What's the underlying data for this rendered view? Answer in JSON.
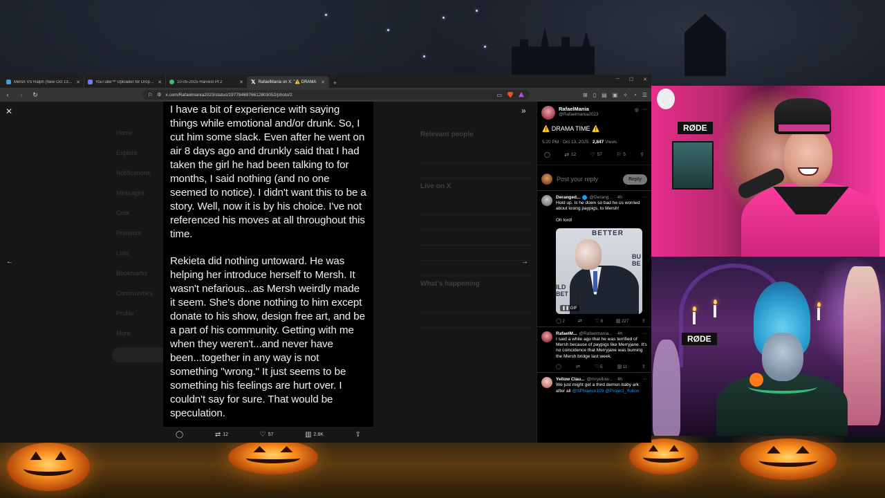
{
  "browser": {
    "tabs": [
      {
        "label": "Mersh VS Ralph (New Oct 13th) - Gi",
        "color": "#3aa0e0",
        "active": false
      },
      {
        "label": "YouTube™ Uploader for Dropbox, D",
        "color": "#6a7cff",
        "active": false
      },
      {
        "label": "10-05-2025 Harvest Pt 2",
        "color": "#3cc06a",
        "active": false
      },
      {
        "label": "RafaelMania on X: \"⚠️ DRAMA",
        "color": "#e7e9ea",
        "active": true
      }
    ],
    "new_tab": "+",
    "url": "x.com/Rafaelmania2023/status/1977846976612803052/photo/2"
  },
  "photo": {
    "paragraphs": [
      "I have a bit of experience with saying things while emotional and/or drunk. So, I cut him some slack. Even after he went on air 8 days ago and drunkly said that I had taken the girl he had been talking to for months, I said nothing (and no one seemed to notice). I didn't want this to be a story. Well, now it is by his choice. I've not referenced his moves at all throughout this time.",
      "Rekieta did nothing untoward. He was helping her introduce herself to Mersh. It wasn't nefarious...as Mersh weirdly made it seem. She's done nothing to him except donate to his show, design free art, and be a part of his community. Getting with me when they weren't...and never have been...together in any way is not something \"wrong.\" It just seems to be something his feelings are hurt over. I couldn't say for sure. That would be speculation."
    ],
    "actions": {
      "reposts": "12",
      "likes": "57",
      "views": "2.8K"
    }
  },
  "background_page": {
    "nav": [
      "Home",
      "Explore",
      "Notifications",
      "Messages",
      "Grok",
      "Premium",
      "Lists",
      "Bookmarks",
      "Communities",
      "Profile",
      "More"
    ],
    "sidebar_heading_1": "Relevant people",
    "sidebar_heading_2": "Live on X",
    "sidebar_heading_3": "What's happening"
  },
  "panel": {
    "author": {
      "name": "RafaelMania",
      "handle": "@Rafaelmania2023"
    },
    "text": "⚠️ DRAMA TIME ⚠️",
    "meta": {
      "time": "5:20 PM · Oct 13, 2025 · ",
      "views": "2,847",
      "views_label": " Views"
    },
    "counts": {
      "reposts": "12",
      "likes": "57",
      "bookmarks": "5"
    },
    "reply_placeholder": "Post your reply",
    "reply_button": "Reply",
    "replies": [
      {
        "name": "Deranged...",
        "handle": "@Derang...",
        "time": "· 4h",
        "verified": true,
        "text": "Hold up. Is he down so bad he us worried about losing paypigs, to Mersh!\n\nOh lord!",
        "media": {
          "better": "BETTER",
          "bu": "BU\nBE",
          "ild": "ILD\nBET",
          "gif": "GIF"
        },
        "counts": {
          "replies": "2",
          "reposts": "",
          "likes": "8",
          "views": "227"
        }
      },
      {
        "name": "RafaelM...",
        "handle": "@Rafaelmania...",
        "time": "· 4h",
        "verified": false,
        "text": "I said a while ago that he was terrified of Mersh because of paypigs like Merryjane. It's no coincidence that Merryjane was burning the Mersh bridge last week.",
        "counts": {
          "replies": "",
          "reposts": "",
          "likes": "5",
          "views": "11"
        }
      },
      {
        "name": "Yellow Clau...",
        "handle": "@mryellow...",
        "time": "· 4h",
        "verified": false,
        "text": "We just might get a third demon baby ark after all ",
        "links": "@SPblanco109 @Project_Yukon"
      }
    ]
  },
  "webcams": {
    "cam1_tag": "RØDE",
    "cam2_tag": "RØDE"
  }
}
